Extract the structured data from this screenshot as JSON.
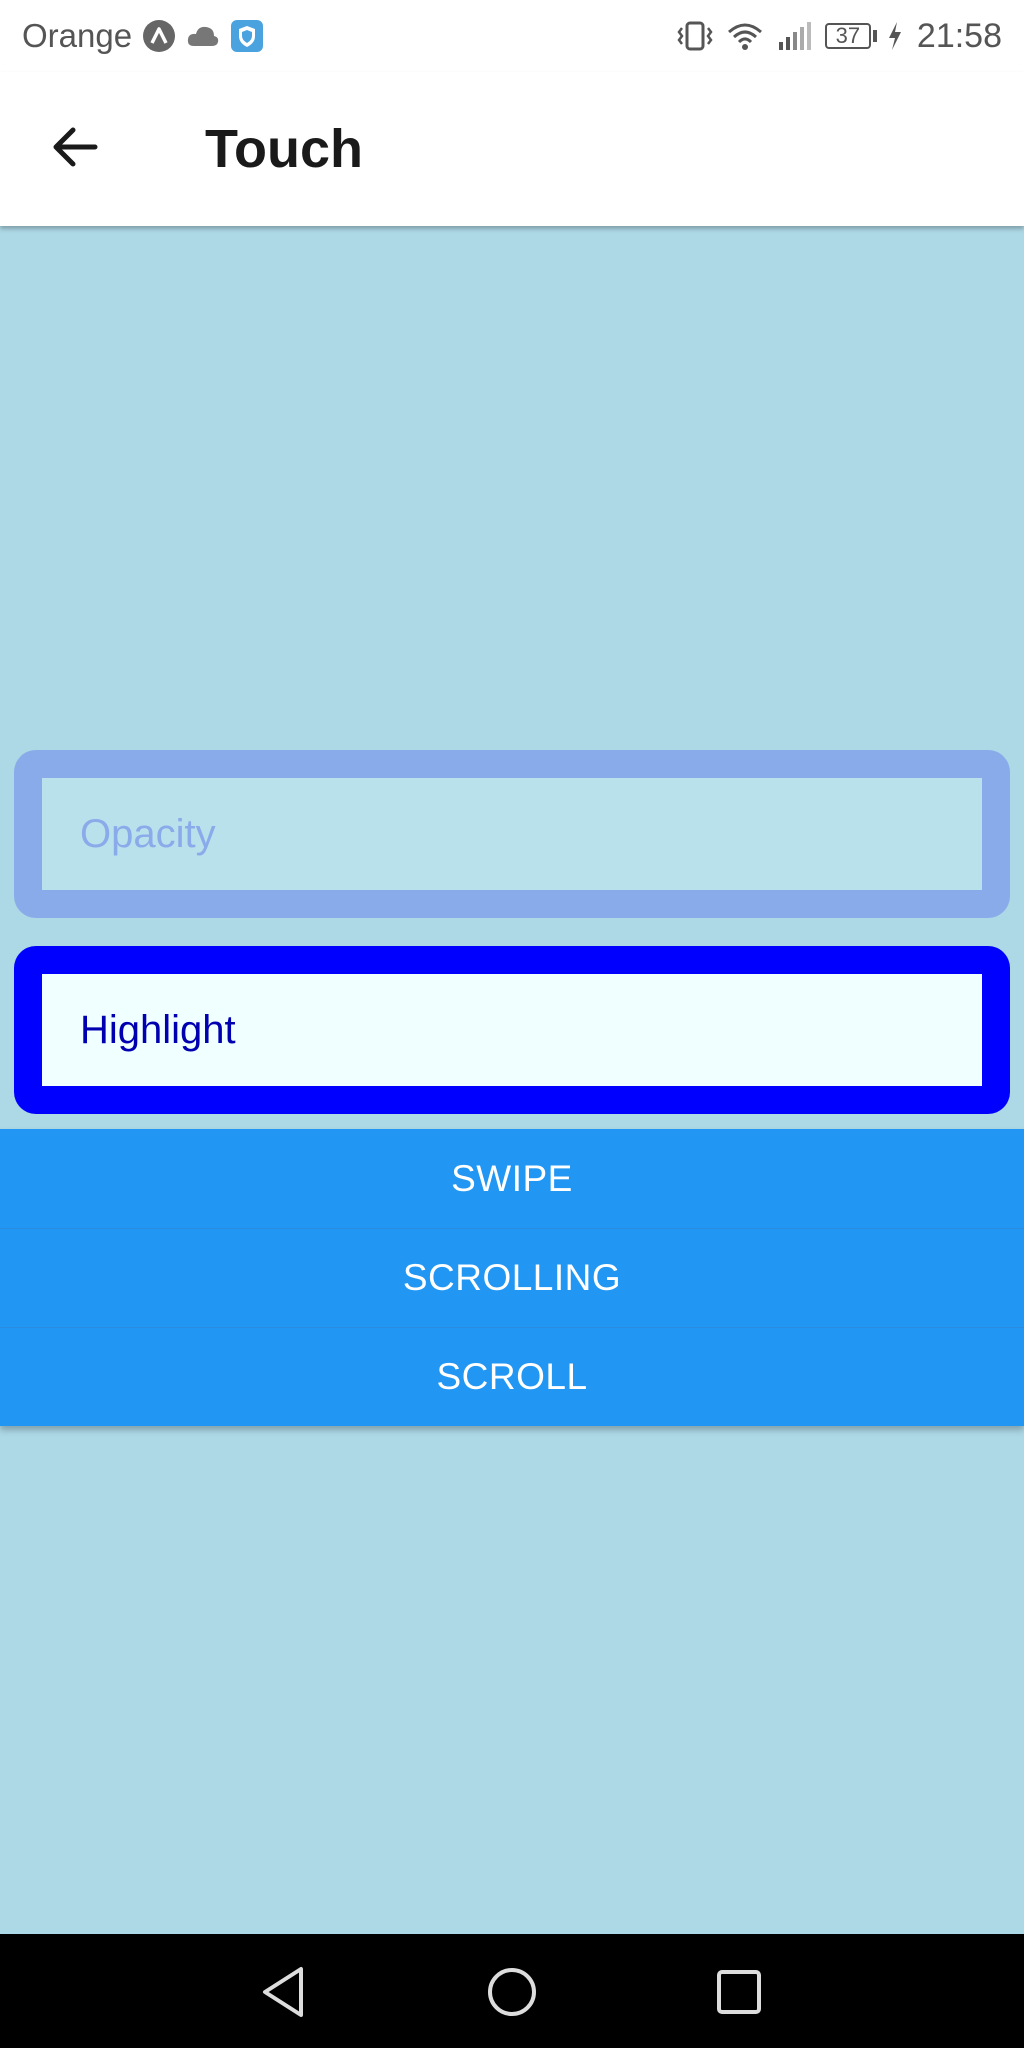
{
  "status_bar": {
    "carrier": "Orange",
    "battery_level": "37",
    "time": "21:58",
    "icons": [
      "android-badge-icon",
      "cloud-icon",
      "shield-icon",
      "vibrate-icon",
      "wifi-icon",
      "signal-icon",
      "battery-icon",
      "charging-bolt-icon"
    ]
  },
  "app_bar": {
    "title": "Touch",
    "back_icon": "arrow-left-icon"
  },
  "main": {
    "opacity_label": "Opacity",
    "highlight_label": "Highlight",
    "buttons": [
      {
        "label": "SWIPE"
      },
      {
        "label": "SCROLLING"
      },
      {
        "label": "SCROLL"
      }
    ]
  },
  "nav_bar": {
    "icons": [
      "back-triangle-icon",
      "home-circle-icon",
      "recents-square-icon"
    ]
  },
  "colors": {
    "background": "#ADD8E6",
    "opacity_border": "#8AABEA",
    "highlight_border": "#0000FF",
    "button": "#2196F3"
  }
}
